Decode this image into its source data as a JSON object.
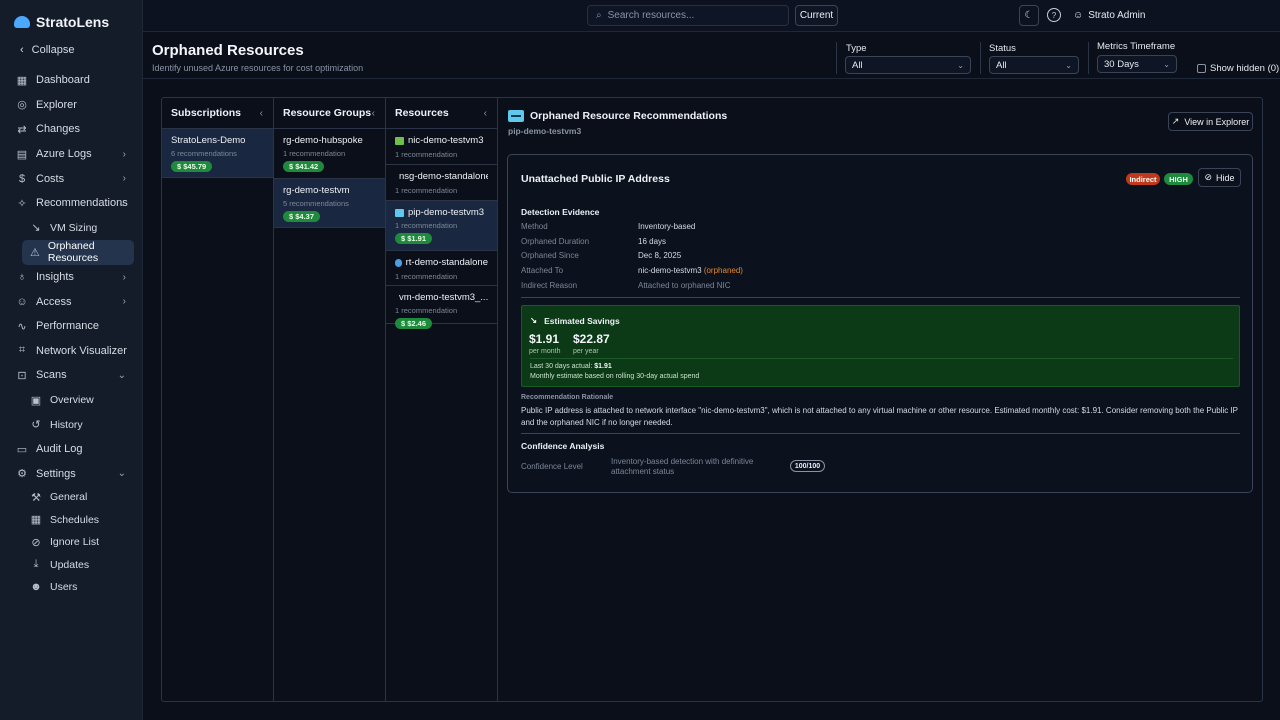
{
  "app": {
    "name": "StratoLens",
    "brand_color": "#4aa8ff"
  },
  "sidebar": {
    "collapse_label": "Collapse",
    "items": [
      {
        "label": "Dashboard",
        "icon": "grid-icon"
      },
      {
        "label": "Explorer",
        "icon": "compass-icon"
      },
      {
        "label": "Changes",
        "icon": "changes-icon"
      },
      {
        "label": "Azure Logs",
        "icon": "logs-icon"
      },
      {
        "label": "Costs",
        "icon": "dollar-icon"
      },
      {
        "label": "Recommendations",
        "icon": "sparkle-icon"
      },
      {
        "label": "VM Sizing",
        "icon": "trend-down-icon"
      },
      {
        "label": "Orphaned Resources",
        "icon": "warning-icon"
      },
      {
        "label": "Insights",
        "icon": "lightbulb-icon"
      },
      {
        "label": "Access",
        "icon": "user-icon"
      },
      {
        "label": "Performance",
        "icon": "activity-icon"
      },
      {
        "label": "Network Visualizer",
        "icon": "network-icon"
      },
      {
        "label": "Scans",
        "icon": "scan-icon"
      },
      {
        "label": "Overview",
        "icon": "overview-icon"
      },
      {
        "label": "History",
        "icon": "history-icon"
      },
      {
        "label": "Audit Log",
        "icon": "document-icon"
      },
      {
        "label": "Settings",
        "icon": "gear-icon"
      },
      {
        "label": "General",
        "icon": "wrench-icon"
      },
      {
        "label": "Schedules",
        "icon": "calendar-icon"
      },
      {
        "label": "Ignore List",
        "icon": "ignore-icon"
      },
      {
        "label": "Updates",
        "icon": "download-icon"
      },
      {
        "label": "Users",
        "icon": "users-icon"
      }
    ]
  },
  "topbar": {
    "search_placeholder": "Search resources...",
    "current_label": "Current",
    "user_name": "Strato Admin"
  },
  "header": {
    "title": "Orphaned Resources",
    "subtitle": "Identify unused Azure resources for cost optimization",
    "type_label": "Type",
    "type_value": "All",
    "status_label": "Status",
    "status_value": "All",
    "timeframe_label": "Metrics Timeframe",
    "timeframe_value": "30 Days",
    "show_hidden_label": "Show hidden (0)"
  },
  "columns": {
    "subscriptions": {
      "title": "Subscriptions",
      "items": [
        {
          "name": "StratoLens-Demo",
          "count": "6 recommendations",
          "cost": "$ $45.79"
        }
      ]
    },
    "resource_groups": {
      "title": "Resource Groups",
      "items": [
        {
          "name": "rg-demo-hubspoke",
          "count": "1 recommendation",
          "cost": "$ $41.42"
        },
        {
          "name": "rg-demo-testvm",
          "count": "5 recommendations",
          "cost": "$ $4.37"
        }
      ]
    },
    "resources": {
      "title": "Resources",
      "items": [
        {
          "name": "nic-demo-testvm3",
          "count": "1 recommendation",
          "icon_color": "#6fc04a"
        },
        {
          "name": "nsg-demo-standalone",
          "count": "1 recommendation",
          "icon_color": "#3f8ad8"
        },
        {
          "name": "pip-demo-testvm3",
          "count": "1 recommendation",
          "cost": "$ $1.91",
          "icon_color": "#5fc8ec"
        },
        {
          "name": "rt-demo-standalone",
          "count": "1 recommendation",
          "icon_color": "#4aa0e0"
        },
        {
          "name": "vm-demo-testvm3_...",
          "count": "1 recommendation",
          "cost": "$ $2.46",
          "icon_color": "#5fb0d8"
        }
      ]
    }
  },
  "detail": {
    "title": "Orphaned Resource Recommendations",
    "subtitle": "pip-demo-testvm3",
    "view_explorer_label": "View in Explorer",
    "card": {
      "title": "Unattached Public IP Address",
      "badge_indirect": "Indirect",
      "badge_high": "HIGH",
      "badge_indirect_color": "#c0391b",
      "badge_high_color": "#1e8a3c",
      "hide_label": "Hide",
      "evidence_title": "Detection Evidence",
      "evidence": [
        {
          "k": "Method",
          "v": "Inventory-based"
        },
        {
          "k": "Orphaned Duration",
          "v": "16 days"
        },
        {
          "k": "Orphaned Since",
          "v": "Dec 8, 2025"
        },
        {
          "k": "Attached To",
          "v": "nic-demo-testvm3",
          "extra": "(orphaned)"
        },
        {
          "k": "Indirect Reason",
          "v": "Attached to orphaned NIC"
        }
      ],
      "savings": {
        "title": "Estimated Savings",
        "monthly": "$1.91",
        "monthly_label": "per month",
        "yearly": "$22.87",
        "yearly_label": "per year",
        "actual_prefix": "Last 30 days actual:",
        "actual_value": "$1.91",
        "note": "Monthly estimate based on rolling 30-day actual spend"
      },
      "rationale_title": "Recommendation Rationale",
      "rationale_text": "Public IP address is attached to network interface \"nic-demo-testvm3\", which is not attached to any virtual machine or other resource. Estimated monthly cost: $1.91. Consider removing both the Public IP and the orphaned NIC if no longer needed.",
      "confidence_title": "Confidence Analysis",
      "confidence_label": "Confidence Level",
      "confidence_desc": "Inventory-based detection with definitive attachment status",
      "confidence_score": "100/100"
    }
  }
}
